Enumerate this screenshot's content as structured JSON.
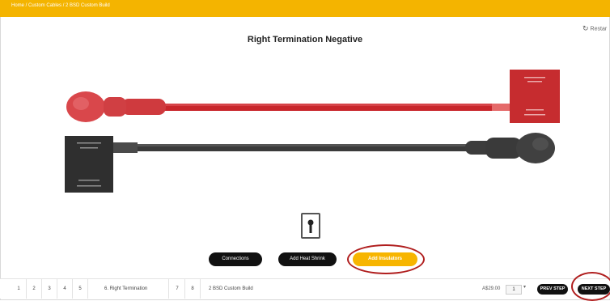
{
  "breadcrumb": "Home / Custom Cables / 2 BSD Custom Build",
  "restart_label": "Restar",
  "page_title": "Right Termination Negative",
  "colors": {
    "accent": "#f4b400",
    "red_cable": "#c8262b",
    "black_cable": "#2b2b2b",
    "highlight_ring": "#b01e1e"
  },
  "picker_icon": "cable-end-icon",
  "options": {
    "connections": "Connections",
    "heat_shrink": "Add Heat Shrink",
    "insulators": "Add Insulators"
  },
  "steps": [
    "1",
    "2",
    "3",
    "4",
    "5",
    "6. Right Termination",
    "7",
    "8"
  ],
  "build_name": "2 BSD Custom Build",
  "price": "A$29.00",
  "quantity": "1",
  "nav": {
    "prev": "PREV STEP",
    "next": "NEXT STEP"
  }
}
